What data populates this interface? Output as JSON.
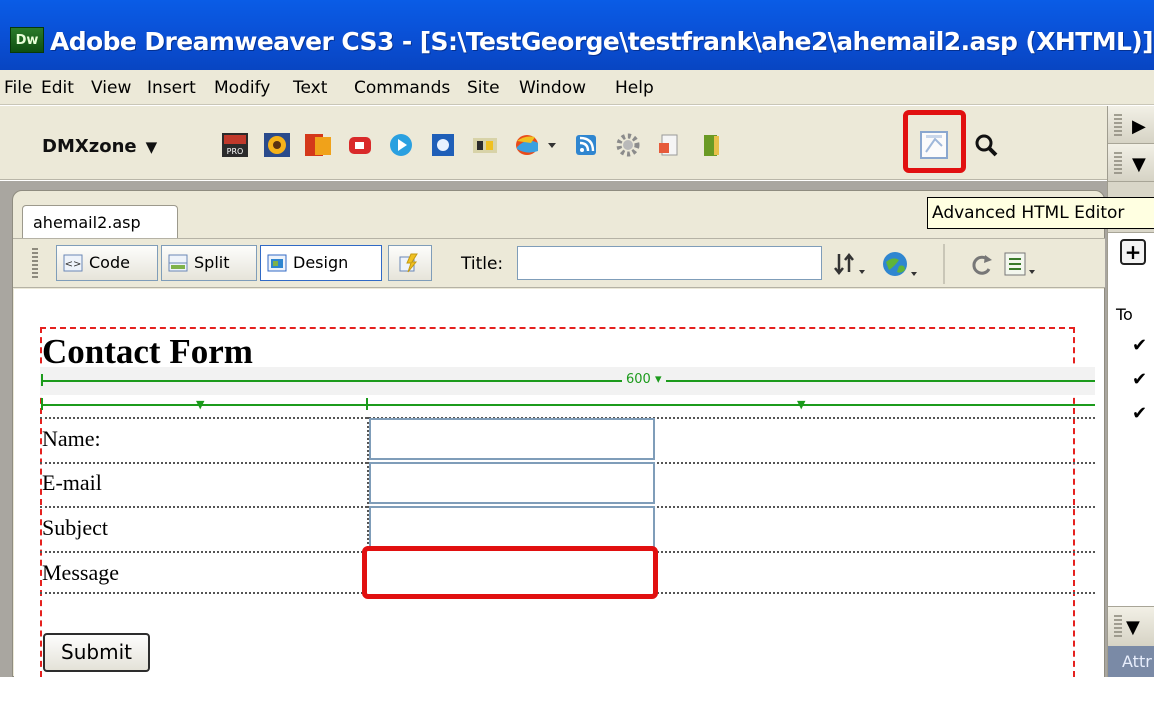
{
  "window": {
    "logo": "Dw",
    "title": "Adobe Dreamweaver CS3 - [S:\\TestGeorge\\testfrank\\ahe2\\ahemail2.asp (XHTML)]"
  },
  "menu": [
    "File",
    "Edit",
    "View",
    "Insert",
    "Modify",
    "Text",
    "Commands",
    "Site",
    "Window",
    "Help"
  ],
  "insert_bar": {
    "category": "DMXzone",
    "icons": [
      "pro-icon",
      "sunflower-icon",
      "flash-movie-icon",
      "red-media-icon",
      "play-button-icon",
      "image-effect-icon",
      "gallery-icon",
      "globe-color-icon",
      "rss-icon",
      "settings-cog-icon",
      "page-icon",
      "book-icon",
      "advanced-html-editor-icon",
      "search-icon"
    ],
    "highlight_color": "#e11010"
  },
  "tooltip": "Advanced HTML Editor",
  "document": {
    "tab": "ahemail2.asp",
    "views": {
      "code": "Code",
      "split": "Split",
      "design": "Design"
    },
    "title_label": "Title:",
    "title_value": ""
  },
  "design": {
    "heading": "Contact Form",
    "table_width": "600",
    "rows": [
      "Name:",
      "E-mail",
      "Subject",
      "Message"
    ],
    "submit": "Submit",
    "guide_color": "#1c9b1c",
    "form_border_color": "#e5211f"
  },
  "side_panel": {
    "to_label": "To",
    "bottom_label": "Attr"
  }
}
